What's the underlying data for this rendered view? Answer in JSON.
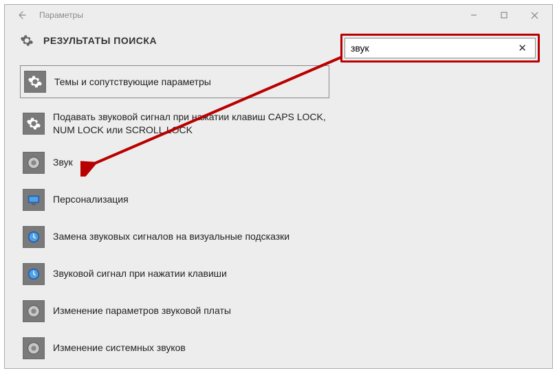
{
  "window": {
    "title": "Параметры"
  },
  "page": {
    "heading": "РЕЗУЛЬТАТЫ ПОИСКА"
  },
  "search": {
    "value": "звук"
  },
  "results": [
    {
      "label": "Темы и сопутствующие параметры",
      "icon": "gear",
      "selected": true
    },
    {
      "label": "Подавать звуковой сигнал при нажатии клавиш CAPS LOCK, NUM LOCK или SCROLL LOCK",
      "icon": "gear",
      "selected": false
    },
    {
      "label": "Звук",
      "icon": "speaker",
      "selected": false
    },
    {
      "label": "Персонализация",
      "icon": "monitor",
      "selected": false
    },
    {
      "label": "Замена звуковых сигналов на визуальные подсказки",
      "icon": "clock",
      "selected": false
    },
    {
      "label": "Звуковой сигнал при нажатии клавиши",
      "icon": "clock",
      "selected": false
    },
    {
      "label": "Изменение параметров звуковой платы",
      "icon": "speaker",
      "selected": false
    },
    {
      "label": "Изменение системных звуков",
      "icon": "speaker",
      "selected": false
    }
  ]
}
